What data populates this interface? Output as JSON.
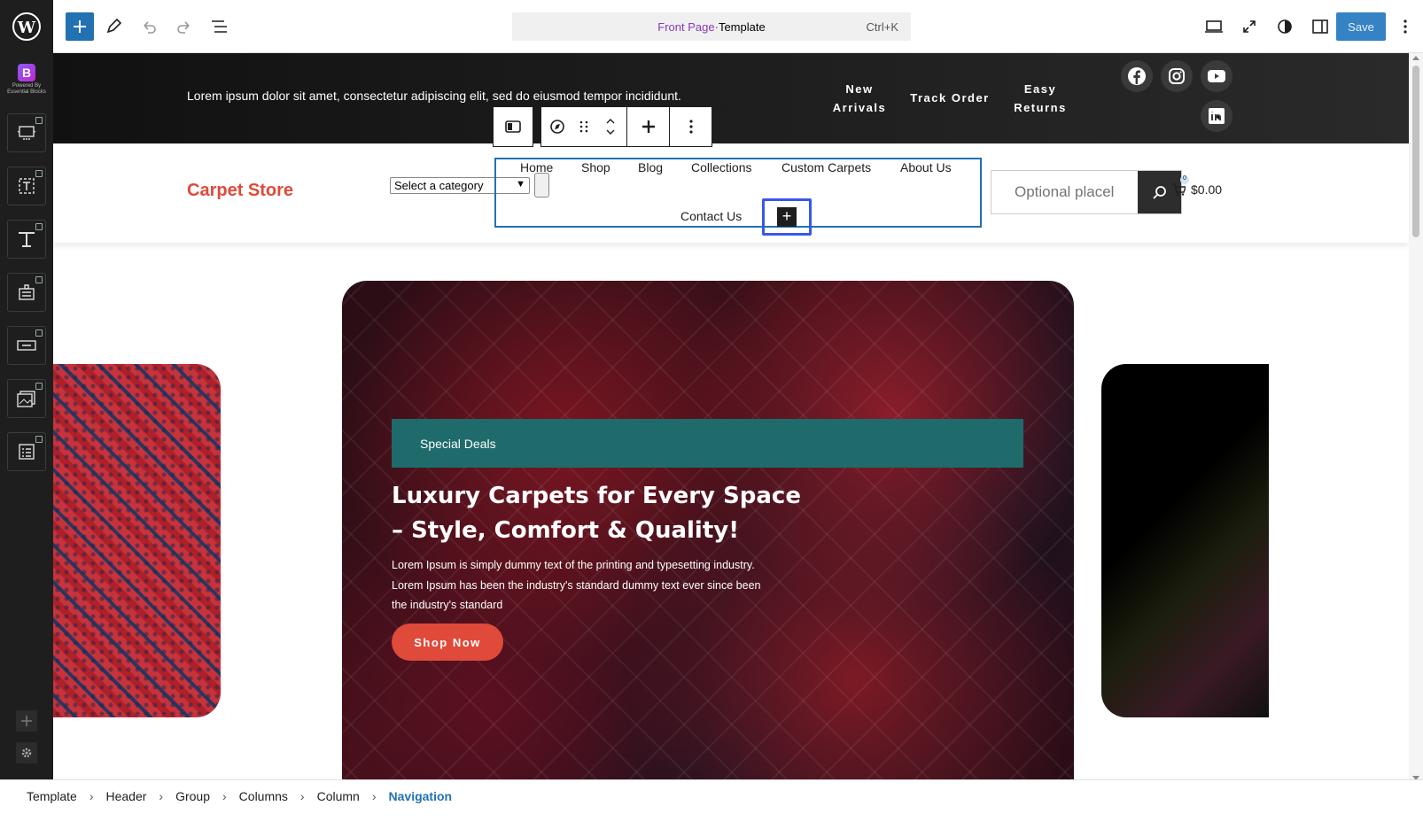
{
  "topbar": {
    "command": {
      "title": "Front Page",
      "sep": " · ",
      "type": "Template",
      "shortcut": "Ctrl+K"
    },
    "save_label": "Save"
  },
  "sidebar": {
    "logo_text": "Powered By Essential Blocks",
    "items": [
      "slider-icon",
      "text-block-icon",
      "typography-icon",
      "form-icon",
      "button-icon",
      "image-gallery-icon",
      "list-icon"
    ]
  },
  "header_top": {
    "tagline": "Lorem ipsum dolor sit amet, consectetur adipiscing elit, sed do eiusmod tempor incididunt.",
    "links": [
      {
        "line1": "New",
        "line2": "Arrivals"
      },
      {
        "line1": "Track Order",
        "line2": ""
      },
      {
        "line1": "Easy",
        "line2": "Returns"
      }
    ],
    "social": [
      "facebook-icon",
      "instagram-icon",
      "youtube-icon",
      "linkedin-icon"
    ]
  },
  "header_main": {
    "brand": "Carpet Store",
    "category_select": "Select a category",
    "nav": [
      "Home",
      "Shop",
      "Blog",
      "Collections",
      "Custom Carpets",
      "About Us",
      "Contact Us"
    ],
    "search_placeholder": "Optional placel",
    "cart_total": "$0.00",
    "cart_badge": "0"
  },
  "hero": {
    "badge": "Special Deals",
    "title": "Luxury Carpets for Every Space – Style, Comfort & Quality!",
    "body": "Lorem Ipsum is simply dummy text of the printing and typesetting industry. Lorem Ipsum has been the industry's standard dummy text  ever since been the industry's standard",
    "cta": "Shop Now"
  },
  "breadcrumb": [
    "Template",
    "Header",
    "Group",
    "Columns",
    "Column",
    "Navigation"
  ],
  "colors": {
    "accent": "#e04a3a",
    "teal": "#1f6b6b",
    "wp_blue": "#2271b1"
  }
}
